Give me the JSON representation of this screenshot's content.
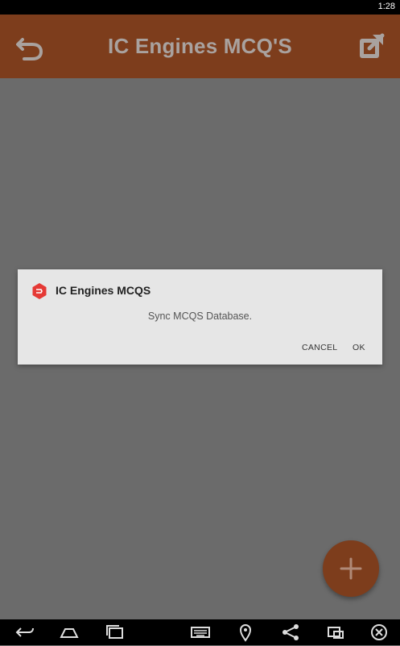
{
  "status_bar": {
    "time": "1:28"
  },
  "app_bar": {
    "title": "IC Engines MCQ'S",
    "back_icon": "undo-arrow-icon",
    "share_icon": "external-link-icon"
  },
  "dialog": {
    "app_name": "IC Engines MCQS",
    "message": "Sync MCQS Database.",
    "cancel_label": "CANCEL",
    "ok_label": "OK",
    "icon": "app-logo-icon"
  },
  "fab": {
    "icon": "plus-icon"
  },
  "nav_bar": {
    "icons": [
      "back-icon",
      "home-icon",
      "recent-apps-icon",
      "keyboard-icon",
      "location-icon",
      "share-icon",
      "screen-icon",
      "close-icon"
    ]
  },
  "colors": {
    "primary_dimmed": "#7d3d1c",
    "overlay_bg": "#6b6b6b",
    "dialog_bg": "#e6e6e6",
    "icon_red": "#e53935"
  }
}
